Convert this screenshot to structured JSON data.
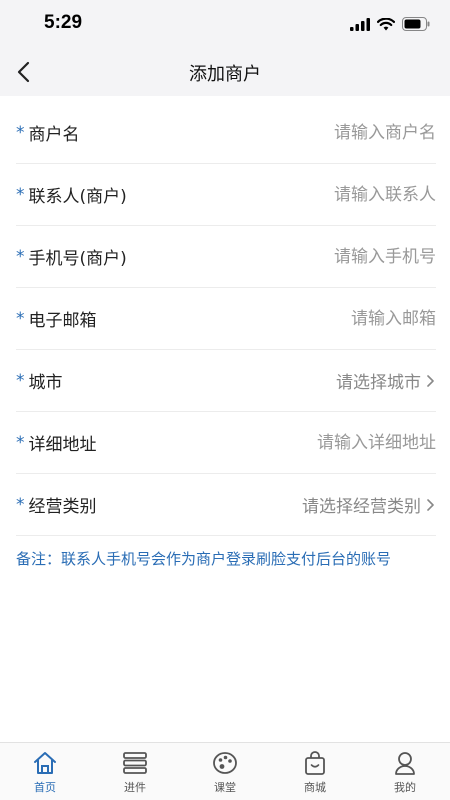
{
  "status_bar": {
    "time": "5:29"
  },
  "nav": {
    "title": "添加商户"
  },
  "form": {
    "required_mark": "*",
    "merchant_name": {
      "label": "商户名",
      "placeholder": "请输入商户名"
    },
    "contact_name": {
      "label": "联系人(商户)",
      "placeholder": "请输入联系人"
    },
    "phone": {
      "label": "手机号(商户)",
      "placeholder": "请输入手机号"
    },
    "email": {
      "label": "电子邮箱",
      "placeholder": "请输入邮箱"
    },
    "city": {
      "label": "城市",
      "placeholder": "请选择城市"
    },
    "address": {
      "label": "详细地址",
      "placeholder": "请输入详细地址"
    },
    "category": {
      "label": "经营类别",
      "placeholder": "请选择经营类别"
    }
  },
  "note": "备注：联系人手机号会作为商户登录刷脸支付后台的账号",
  "tabs": [
    {
      "label": "首页",
      "icon": "home-icon",
      "active": true
    },
    {
      "label": "进件",
      "icon": "list-icon",
      "active": false
    },
    {
      "label": "课堂",
      "icon": "palette-icon",
      "active": false
    },
    {
      "label": "商城",
      "icon": "shopping-bag-icon",
      "active": false
    },
    {
      "label": "我的",
      "icon": "user-icon",
      "active": false
    }
  ],
  "colors": {
    "accent": "#2a6db5",
    "header_bg": "#f4f4f6",
    "placeholder": "#999999"
  }
}
